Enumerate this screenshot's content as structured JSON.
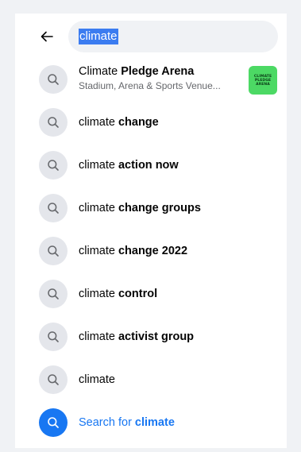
{
  "header": {
    "back_icon": "arrow-left-icon",
    "search_query": "climate"
  },
  "top_result": {
    "title_regular": "Climate ",
    "title_bold": "Pledge Arena",
    "subtitle": "Stadium, Arena & Sports Venue...",
    "thumbnail_lines": [
      "CLIMATE",
      "PLEDGE",
      "ARENA"
    ],
    "thumbnail_color": "#4cd964"
  },
  "suggestions": [
    {
      "regular": "climate ",
      "bold": "change"
    },
    {
      "regular": "climate ",
      "bold": "action now"
    },
    {
      "regular": "climate ",
      "bold": "change groups"
    },
    {
      "regular": "climate ",
      "bold": "change 2022"
    },
    {
      "regular": "climate ",
      "bold": "control"
    },
    {
      "regular": "climate ",
      "bold": "activist group"
    },
    {
      "regular": "climate",
      "bold": ""
    }
  ],
  "search_for": {
    "prefix": "Search for ",
    "query": "climate"
  },
  "colors": {
    "accent": "#1877f2",
    "selection": "#3b7cf0",
    "icon_circle": "#e4e6eb"
  }
}
